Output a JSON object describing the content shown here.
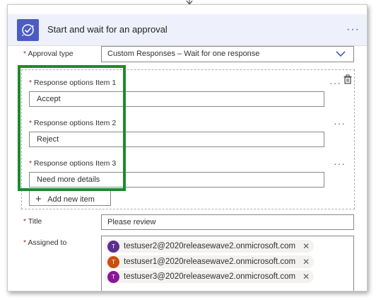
{
  "header": {
    "title": "Start and wait for an approval",
    "more_label": "···"
  },
  "approval_type": {
    "label": "Approval type",
    "required": "*",
    "value": "Custom Responses – Wait for one response"
  },
  "response_options": {
    "items": [
      {
        "label": "Response options Item 1",
        "value": "Accept"
      },
      {
        "label": "Response options Item 2",
        "value": "Reject"
      },
      {
        "label": "Response options Item 3",
        "value": "Need more details"
      }
    ],
    "more_label": "···",
    "add_label": "Add new item"
  },
  "title_field": {
    "label": "Title",
    "required": "*",
    "value": "Please review"
  },
  "assigned_to": {
    "label": "Assigned to",
    "required": "*",
    "users": [
      {
        "initial": "T",
        "email": "testuser2@2020releasewave2.onmicrosoft.com",
        "color": "#5c2e91"
      },
      {
        "initial": "T",
        "email": "testuser1@2020releasewave2.onmicrosoft.com",
        "color": "#ca5010"
      },
      {
        "initial": "T",
        "email": "testuser3@2020releasewave2.onmicrosoft.com",
        "color": "#881798"
      }
    ],
    "remove_label": "✕"
  },
  "colors": {
    "accent": "#4b5cc4",
    "highlight": "#1e8a2e",
    "required": "#a4262c"
  }
}
